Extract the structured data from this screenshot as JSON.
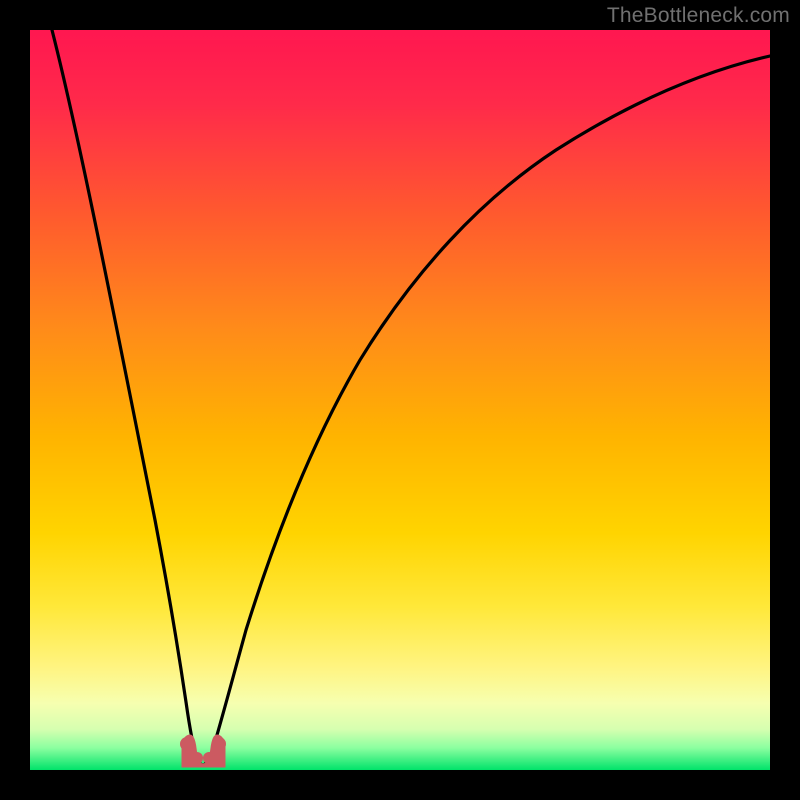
{
  "watermark": "TheBottleneck.com",
  "chart_data": {
    "type": "line",
    "title": "",
    "xlabel": "",
    "ylabel": "",
    "xlim": [
      0,
      100
    ],
    "ylim": [
      0,
      100
    ],
    "grid": false,
    "series": [
      {
        "name": "curve",
        "x": [
          3,
          6,
          10,
          14,
          17,
          19,
          20.5,
          22,
          23,
          24,
          26,
          29,
          33,
          38,
          44,
          51,
          59,
          68,
          78,
          89,
          100
        ],
        "values": [
          100,
          79,
          58,
          36,
          18,
          7,
          2,
          1,
          2,
          6,
          15,
          28,
          42,
          54,
          64,
          72,
          79,
          84.5,
          89,
          92.5,
          95
        ]
      },
      {
        "name": "green-band",
        "x": [
          0,
          100
        ],
        "values": [
          3,
          3
        ]
      },
      {
        "name": "nub",
        "x": [
          20,
          21,
          22,
          23,
          24
        ],
        "values": [
          3,
          1.5,
          1,
          1.5,
          3
        ]
      }
    ],
    "colors": {
      "gradient_top": "#ff1744",
      "gradient_mid1": "#ff6a00",
      "gradient_mid2": "#ffc400",
      "gradient_mid3": "#ffee58",
      "gradient_bottom": "#00e676",
      "curve": "#000000",
      "nub": "#cc5a61"
    }
  }
}
